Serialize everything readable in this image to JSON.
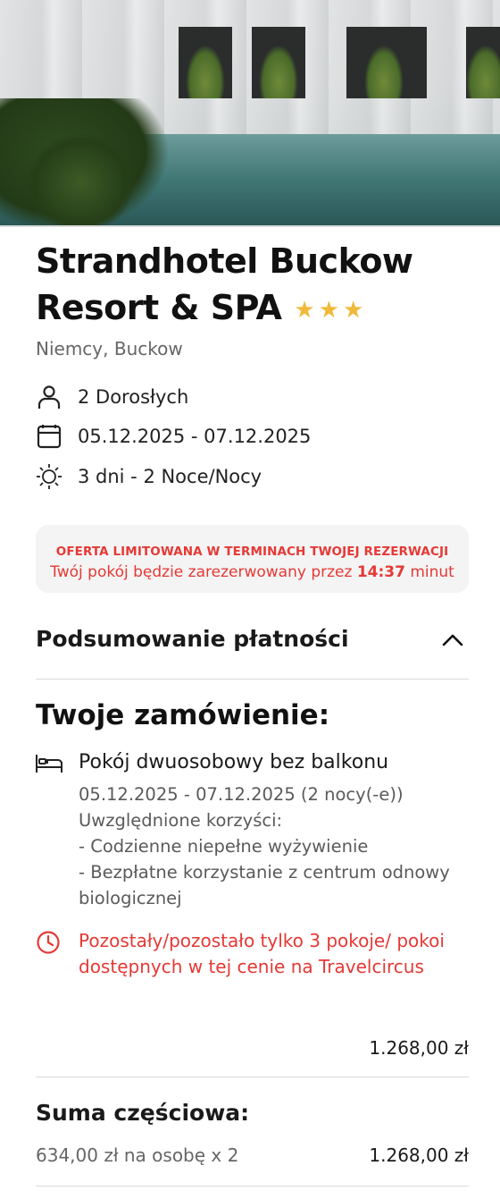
{
  "hotel": {
    "name": "Strandhotel Buckow Resort & SPA",
    "stars": "★★★",
    "location": "Niemcy, Buckow"
  },
  "booking": {
    "guests": "2 Dorosłych",
    "dates": "05.12.2025 - 07.12.2025",
    "duration": "3 dni - 2 Noce/Nocy"
  },
  "offer": {
    "headline": "OFERTA LIMITOWANA W TERMINACH TWOJEJ REZERWACJI",
    "message_prefix": "Twój pokój będzie zarezerwowany przez",
    "time": "14:37",
    "message_suffix": "minut"
  },
  "summary": {
    "label": "Podsumowanie płatności"
  },
  "order": {
    "title": "Twoje zamówienie:",
    "room_name": "Pokój dwuosobowy bez balkonu",
    "room_dates": "05.12.2025 - 07.12.2025 (2 nocy(-e))",
    "benefits_label": "Uwzględnione korzyści:",
    "benefit_1": "- Codzienne niepełne wyżywienie",
    "benefit_2": "- Bezpłatne korzystanie z centrum odnowy biologicznej",
    "availability_warning": "Pozostały/pozostało tylko 3 pokoje/ pokoi dostępnych w tej cenie na Travelcircus",
    "room_price": "1.268,00 zł"
  },
  "subtotal": {
    "title": "Suma częściowa:",
    "per_person": "634,00 zł na osobę x 2",
    "amount": "1.268,00 zł"
  },
  "colors": {
    "accent_red": "#e53935",
    "star_gold": "#f0b93a"
  },
  "icons": {
    "guests": "person-icon",
    "dates": "calendar-icon",
    "duration": "sun-icon",
    "collapse": "chevron-up-icon",
    "room": "bed-icon",
    "warning": "clock-icon"
  }
}
